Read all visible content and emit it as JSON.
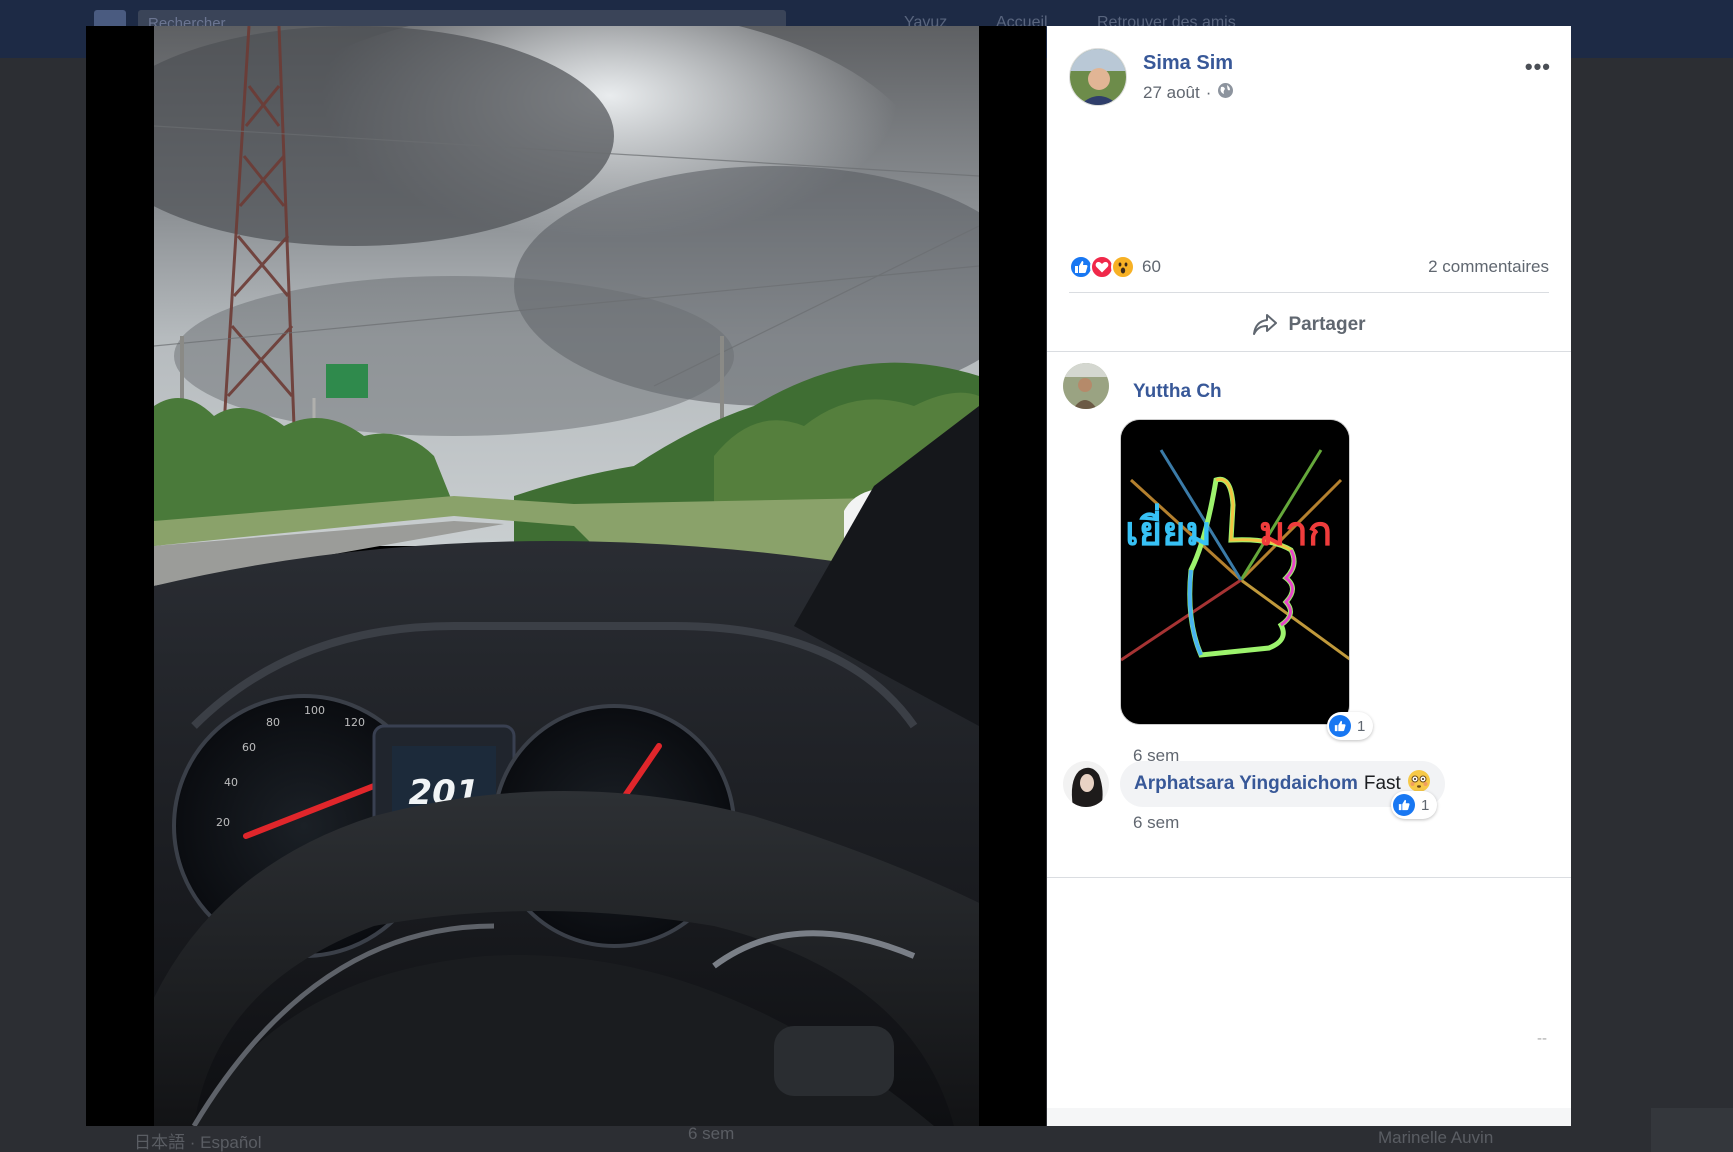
{
  "background": {
    "search_placeholder": "Rechercher",
    "nav_items": [
      "Yavuz",
      "Accueil",
      "Retrouver des amis"
    ],
    "footer_languages": "日本語 · Español",
    "footer_time": "6 sem",
    "footer_name": "Marinelle Auvin"
  },
  "photo": {
    "speed_readout": "201"
  },
  "post": {
    "author": "Sima Sim",
    "date": "27 août",
    "date_separator": "·",
    "privacy_icon": "globe-icon",
    "more_label": "•••",
    "reactions": [
      "like",
      "love",
      "wow"
    ],
    "reaction_count": "60",
    "comment_count": "2 commentaires",
    "share_label": "Partager"
  },
  "comments": [
    {
      "name": "Yuttha Ch",
      "sticker_text_left": "เยี่ยม",
      "sticker_text_right": "มาก",
      "likes": "1",
      "time": "6 sem"
    },
    {
      "name": "Arphatsara Yingdaichom",
      "text": "Fast",
      "emoji": "😳",
      "likes": "1",
      "time": "6 sem"
    }
  ],
  "panel_footer": "--",
  "colors": {
    "link_blue": "#385898",
    "like_blue": "#1877f2",
    "love_red": "#f0284a",
    "wow_yellow": "#f7b125"
  }
}
